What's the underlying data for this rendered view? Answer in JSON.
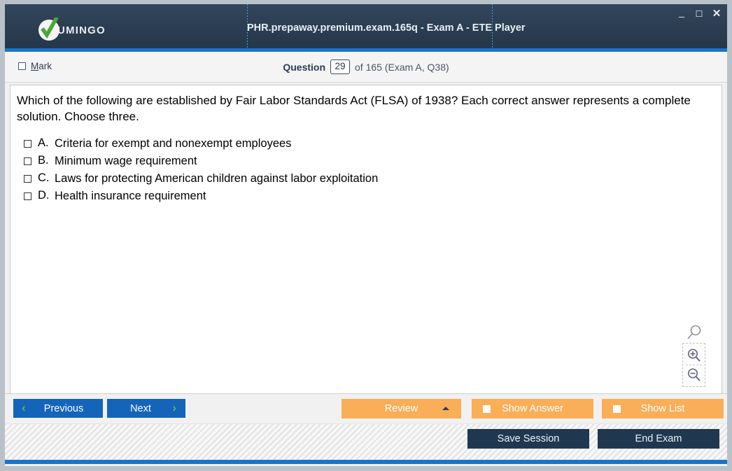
{
  "window": {
    "logo_text": "UMINGO",
    "title": "PHR.prepaway.premium.exam.165q - Exam A - ETE Player",
    "minimize": "_",
    "maximize": "☐",
    "close": "✕"
  },
  "qheader": {
    "mark_accel": "M",
    "mark_label_rest": "ark",
    "question_label": "Question",
    "question_number": "29",
    "tail": "of 165 (Exam A, Q38)"
  },
  "question": {
    "text": "Which of the following are established by Fair Labor Standards Act (FLSA) of 1938? Each correct answer represents a complete solution. Choose three.",
    "options": [
      {
        "letter": "A.",
        "text": "Criteria for exempt and nonexempt employees",
        "checked": false
      },
      {
        "letter": "B.",
        "text": "Minimum wage requirement",
        "checked": false
      },
      {
        "letter": "C.",
        "text": "Laws for protecting American children against labor exploitation",
        "checked": false
      },
      {
        "letter": "D.",
        "text": "Health insurance requirement",
        "checked": false
      }
    ]
  },
  "zoom_controls": {
    "handle": "magnifier-icon",
    "zoom_in": "zoom-in-icon",
    "zoom_out": "zoom-out-icon"
  },
  "buttons": {
    "previous": "Previous",
    "previous_chevron": "‹",
    "next": "Next",
    "next_chevron": "›",
    "review": "Review",
    "show_answer": "Show Answer",
    "show_list": "Show List",
    "save_session": "Save Session",
    "end_exam": "End Exam"
  },
  "colors": {
    "titlebar_dark": "#2c3e52",
    "accent_blue": "#1874c8",
    "button_blue": "#1464ba",
    "chevron_green": "#5fbb46",
    "orange": "#f9ae57",
    "dark_button": "#1f3850"
  }
}
